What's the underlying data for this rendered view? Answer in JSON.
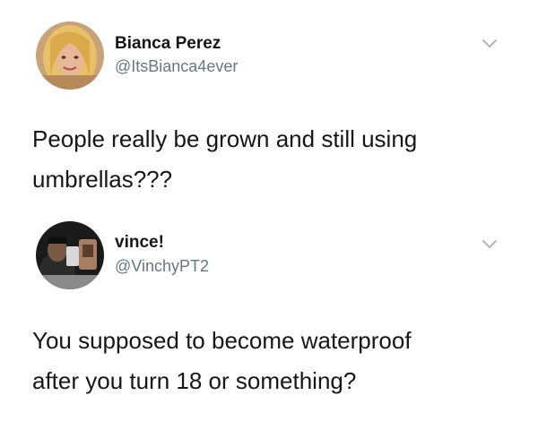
{
  "tweets": [
    {
      "display_name": "Bianca Perez",
      "handle": "@ItsBianca4ever",
      "text_lines": [
        "People really be grown and still using",
        "umbrellas???"
      ],
      "avatar_icon": "profile-photo",
      "menu_icon": "chevron-down-icon"
    },
    {
      "display_name": "vince!",
      "handle": "@VinchyPT2",
      "text_lines": [
        "You supposed to become waterproof",
        "after you turn 18 or something?"
      ],
      "avatar_icon": "profile-photo",
      "menu_icon": "chevron-down-icon"
    }
  ],
  "colors": {
    "text": "#14171a",
    "handle": "#657786",
    "chevron": "#aab8c2"
  }
}
